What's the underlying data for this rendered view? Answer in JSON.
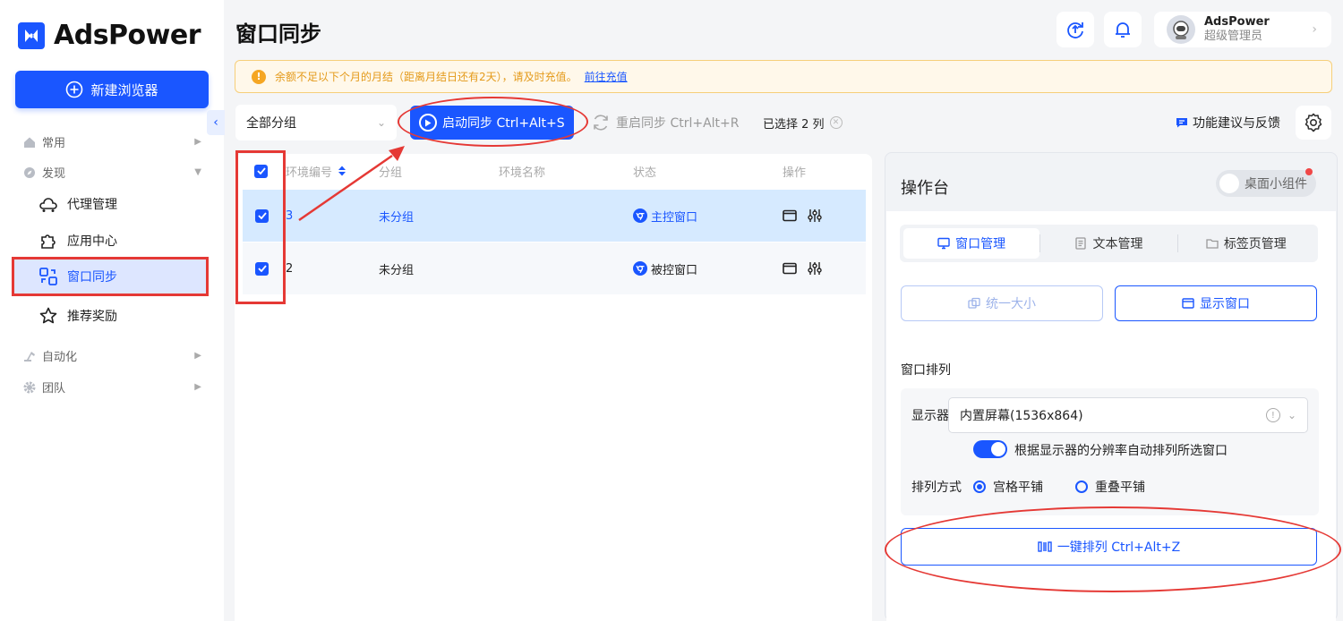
{
  "app": {
    "name": "AdsPower",
    "brand_color": "#1a56ff"
  },
  "sidebar": {
    "new_browser_label": "新建浏览器",
    "collapse_icon": "chevron-left-icon",
    "groups": [
      {
        "label": "常用",
        "icon": "home-icon",
        "expanded": false
      },
      {
        "label": "发现",
        "icon": "compass-icon",
        "expanded": true
      },
      {
        "label": "自动化",
        "icon": "robot-arm-icon",
        "expanded": false
      },
      {
        "label": "团队",
        "icon": "gear-icon",
        "expanded": false
      }
    ],
    "items": [
      {
        "label": "代理管理",
        "icon": "proxy-network-icon"
      },
      {
        "label": "应用中心",
        "icon": "puzzle-icon"
      },
      {
        "label": "窗口同步",
        "icon": "window-sync-icon",
        "active": true
      },
      {
        "label": "推荐奖励",
        "icon": "star-icon"
      }
    ]
  },
  "header": {
    "title": "窗口同步",
    "upload_icon": "upload-sync-icon",
    "bell_icon": "bell-icon",
    "user": {
      "name": "AdsPower",
      "role": "超级管理员"
    }
  },
  "notice": {
    "text": "余额不足以下个月的月结（距离月结日还有2天），请及时充值。",
    "link": "前往充值",
    "color": "#e49a1a"
  },
  "toolbar": {
    "group_select": "全部分组",
    "start_sync": "启动同步 Ctrl+Alt+S",
    "restart_sync": "重启同步 Ctrl+Alt+R",
    "selected_count": "已选择 2 列",
    "feedback": "功能建议与反馈"
  },
  "table": {
    "columns": [
      "环境编号",
      "分组",
      "环境名称",
      "状态",
      "操作"
    ],
    "rows": [
      {
        "id": "3",
        "group": "未分组",
        "name": "",
        "status": "主控窗口",
        "checked": true
      },
      {
        "id": "2",
        "group": "未分组",
        "name": "",
        "status": "被控窗口",
        "checked": true
      }
    ]
  },
  "console": {
    "title": "操作台",
    "widget_toggle": "桌面小组件",
    "tabs": [
      "窗口管理",
      "文本管理",
      "标签页管理"
    ],
    "active_tab": 0,
    "unify_size": "统一大小",
    "show_window": "显示窗口",
    "arrange_section": "窗口排列",
    "display_label": "显示器",
    "display_value": "内置屏幕(1536x864)",
    "auto_arrange": "根据显示器的分辨率自动排列所选窗口",
    "auto_arrange_on": true,
    "arrange_mode_label": "排列方式",
    "modes": [
      "宫格平铺",
      "重叠平铺"
    ],
    "mode_selected": 0,
    "arrange_button": "一键排列 Ctrl+Alt+Z"
  },
  "annotation_color": "#e53935"
}
